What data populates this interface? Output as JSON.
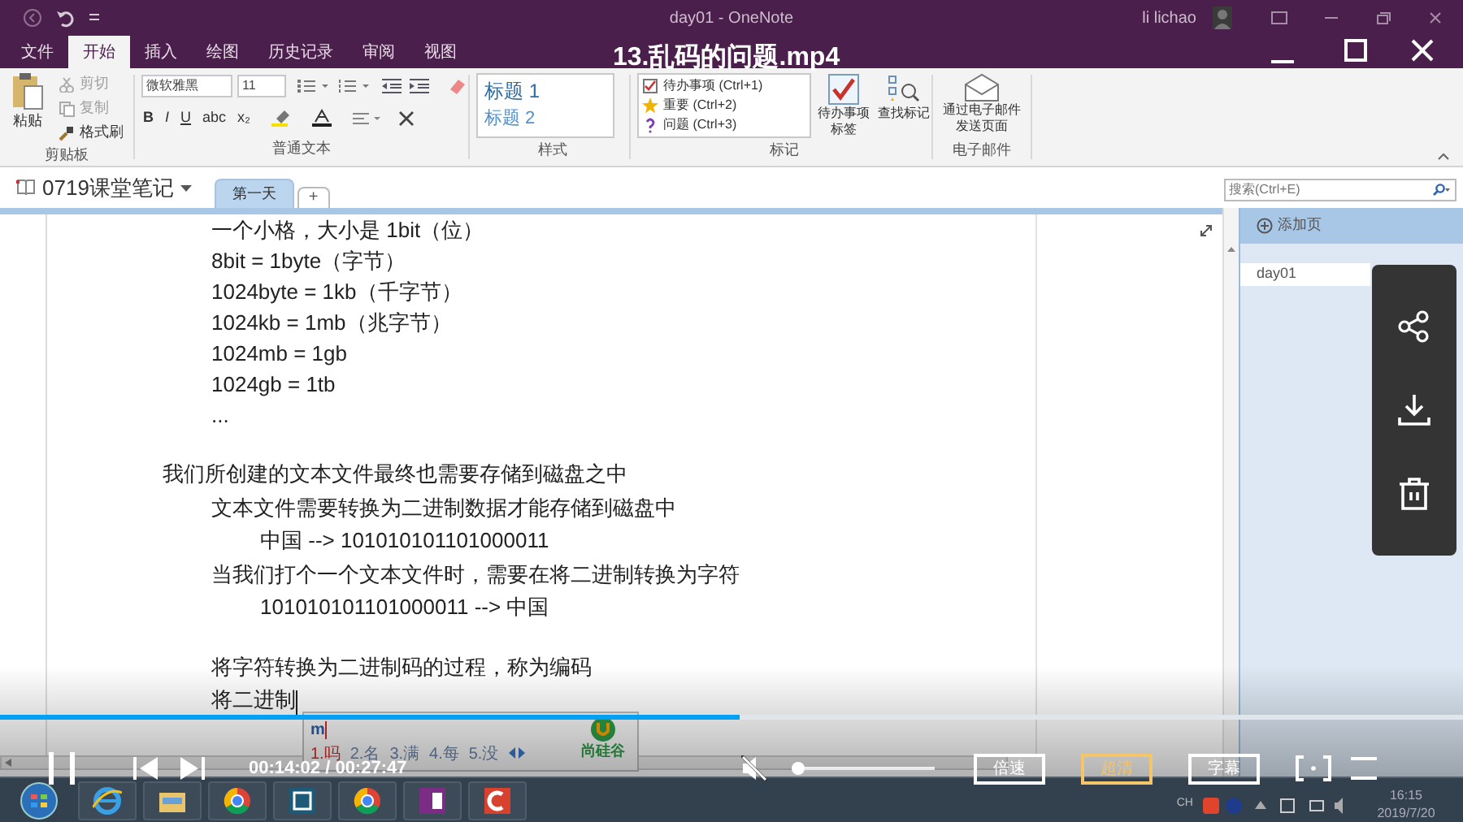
{
  "player": {
    "title": "13.乱码的问题.mp4",
    "playing": true,
    "progress": {
      "level": 0.505
    },
    "time": "00:14:02 / 00:27:47",
    "muted": true,
    "volume": {
      "level": 0
    },
    "buttons": [
      {
        "label": "倍速",
        "selected": false
      },
      {
        "label": "超清",
        "selected": true
      },
      {
        "label": "字幕",
        "selected": false
      }
    ]
  },
  "onenote": {
    "title": "day01 - OneNote",
    "user": "li lichao",
    "tabs": [
      {
        "label": "文件",
        "selected": false
      },
      {
        "label": "开始",
        "selected": true
      },
      {
        "label": "插入",
        "selected": false
      },
      {
        "label": "绘图",
        "selected": false
      },
      {
        "label": "历史记录",
        "selected": false
      },
      {
        "label": "审阅",
        "selected": false
      },
      {
        "label": "视图",
        "selected": false
      }
    ],
    "ribbon": {
      "clipboard": {
        "label": "剪贴板",
        "paste": "粘贴",
        "cut": {
          "label": "剪切",
          "disabled": true
        },
        "copy": {
          "label": "复制",
          "disabled": true
        },
        "format_painter": {
          "label": "格式刷",
          "disabled": false
        }
      },
      "text": {
        "label": "普通文本",
        "font": "微软雅黑",
        "size": "11",
        "format_buttons": [
          "B",
          "I",
          "U",
          "abc",
          "x₂"
        ]
      },
      "styles": {
        "label": "样式",
        "items": [
          "标题 1",
          "标题 2"
        ]
      },
      "tags": {
        "label": "标记",
        "items": [
          {
            "kind": "todo",
            "label": "待办事项 (Ctrl+1)"
          },
          {
            "kind": "important",
            "label": "重要 (Ctrl+2)"
          },
          {
            "kind": "question",
            "label": "问题 (Ctrl+3)"
          }
        ],
        "todo_button": "待办事项标签",
        "find_button": "查找标记"
      },
      "email": {
        "label": "电子邮件",
        "button": "通过电子邮件发送页面"
      }
    },
    "notebook": {
      "name": "0719课堂笔记",
      "sections": [
        {
          "label": "第一天",
          "selected": true
        }
      ],
      "add_section": "+",
      "search": {
        "placeholder": "搜索(Ctrl+E)"
      }
    },
    "outline": [
      {
        "children": [
          {
            "text": "一个小格，大小是 1bit（位）"
          },
          {
            "text": "8bit = 1byte（字节）"
          },
          {
            "text": "1024byte = 1kb（千字节）"
          },
          {
            "text": "1024kb = 1mb（兆字节）"
          },
          {
            "text": "1024mb = 1gb"
          },
          {
            "text": "1024gb = 1tb"
          },
          {
            "text": "..."
          }
        ]
      },
      {
        "text": "我们所创建的文本文件最终也需要存储到磁盘之中",
        "blank_before": true,
        "children": [
          {
            "text": "文本文件需要转换为二进制数据才能存储到磁盘中",
            "children": [
              {
                "text": "中国 --> 101010101101000011"
              }
            ]
          },
          {
            "text": "当我们打个一个文本文件时，需要在将二进制转换为字符",
            "children": [
              {
                "text": "101010101101000011 --> 中国"
              }
            ]
          },
          {
            "text": "将字符转换为二进制码的过程，称为编码",
            "blank_before": true
          },
          {
            "text": "将二进制",
            "cursor": true
          }
        ]
      }
    ],
    "pages": {
      "add_page": "添加页",
      "items": [
        {
          "title": "day01",
          "selected": true
        }
      ]
    },
    "ime": {
      "input": "m",
      "candidates": [
        {
          "label": "1.吗",
          "selected": true
        },
        {
          "label": "2.名",
          "selected": false
        },
        {
          "label": "3.满",
          "selected": false
        },
        {
          "label": "4.每",
          "selected": false
        },
        {
          "label": "5.没",
          "selected": false
        }
      ],
      "brand": "尚硅谷"
    }
  },
  "taskbar": {
    "language": "CH",
    "time": "16:15",
    "date": "2019/7/20"
  }
}
